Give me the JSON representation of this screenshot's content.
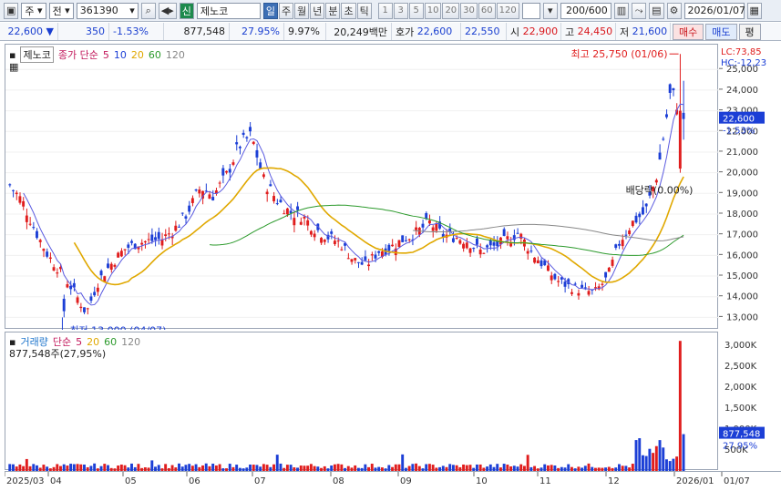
{
  "toolbar": {
    "market": "주",
    "jeon": "전",
    "code": "361390",
    "shin": "신",
    "stock_name": "제노코",
    "periods": [
      "일",
      "주",
      "월",
      "년",
      "분",
      "초",
      "틱"
    ],
    "minutes": [
      "1",
      "3",
      "5",
      "10",
      "20",
      "30",
      "60",
      "120"
    ],
    "count": "200/600",
    "date": "2026/01/07",
    "icons": [
      "chart-type-icon",
      "dropdown-icon",
      "search-icon",
      "speaker-icon",
      "bar-icon",
      "save-icon",
      "settings-icon",
      "calendar-icon"
    ]
  },
  "info": {
    "price": "22,600",
    "change": "350",
    "change_pct": "-1.53%",
    "volume": "877,548",
    "vol_ratio": "27.95%",
    "turnover": "9.97%",
    "amount": "20,249백만",
    "quote_label": "호가",
    "ask": "22,600",
    "bid": "22,550",
    "open_label": "시",
    "open": "22,900",
    "high_label": "고",
    "high": "24,450",
    "low_label": "저",
    "low": "21,600",
    "buy": "매수",
    "sell": "매도",
    "eval": "평"
  },
  "price_legend": {
    "name": "제노코",
    "ma_label": "종가 단순",
    "mas": [
      "5",
      "10",
      "20",
      "60",
      "120"
    ]
  },
  "volume_legend": {
    "name": "거래량",
    "ma_label": "단순",
    "mas": [
      "5",
      "20",
      "60",
      "120"
    ],
    "value": "877,548주(27,95%)"
  },
  "annotations": {
    "high": "최고 25,750 (01/06)",
    "low": "최저 13,000 (04/07)",
    "dividend": "배당락(0.00%)",
    "lc": "LC:73,85",
    "hc": "HC:-12,23",
    "last_price": "22,600",
    "last_pct": "-1.53%",
    "last_vol": "877,548",
    "last_vol_pct": "27.95%"
  },
  "colors": {
    "up": "#e01d1d",
    "down": "#1c3fd6",
    "ma5": "#5a5ae0",
    "ma20": "#e0a800",
    "ma60": "#2c9a2c",
    "ma120": "#888888"
  },
  "chart_data": {
    "type": "candlestick",
    "price_axis": {
      "ticks": [
        13000,
        14000,
        15000,
        16000,
        17000,
        18000,
        19000,
        20000,
        21000,
        22000,
        23000,
        24000,
        25000
      ],
      "ylim": [
        12400,
        26200
      ]
    },
    "volume_axis": {
      "ticks": [
        "500K",
        "1,000K",
        "1,500K",
        "2,000K",
        "2,500K",
        "3,000K"
      ],
      "ylim": [
        0,
        3300000
      ]
    },
    "x_labels": [
      "2025/03",
      "04",
      "05",
      "06",
      "07",
      "08",
      "09",
      "10",
      "11",
      "12",
      "2026/01",
      "01/07"
    ],
    "approx_closes": [
      19400,
      18600,
      17200,
      16000,
      15200,
      14300,
      13200,
      14800,
      15600,
      16300,
      16600,
      16700,
      16800,
      17300,
      18100,
      19300,
      18900,
      19800,
      21300,
      21800,
      19600,
      18700,
      18100,
      17900,
      17300,
      16900,
      16600,
      15800,
      15500,
      16200,
      16400,
      16800,
      17100,
      17600,
      17000,
      16900,
      16700,
      16200,
      16400,
      16700,
      17100,
      16200,
      15500,
      14800,
      14500,
      14300,
      14200,
      14900,
      16700,
      17600,
      18100,
      20100,
      24000,
      22600
    ],
    "volume_peaks": {
      "2026/01/06": 3100000,
      "2026/01/07": 877548
    }
  }
}
